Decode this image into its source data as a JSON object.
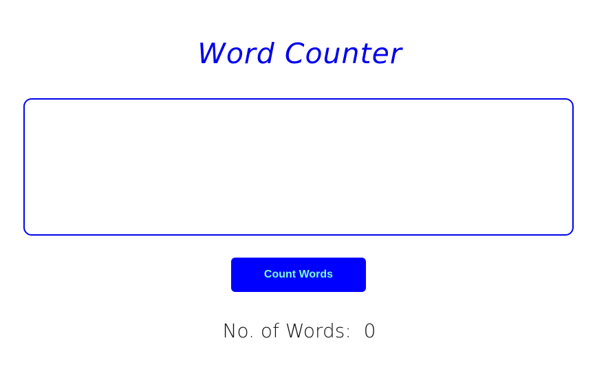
{
  "app": {
    "title": "Word Counter"
  },
  "input": {
    "value": "",
    "placeholder": ""
  },
  "button": {
    "label": "Count Words"
  },
  "result": {
    "label": "No. of Words:",
    "count": "0"
  },
  "colors": {
    "accent": "#0000ee",
    "button_bg": "#0000ff",
    "button_text": "#7fffd4"
  }
}
